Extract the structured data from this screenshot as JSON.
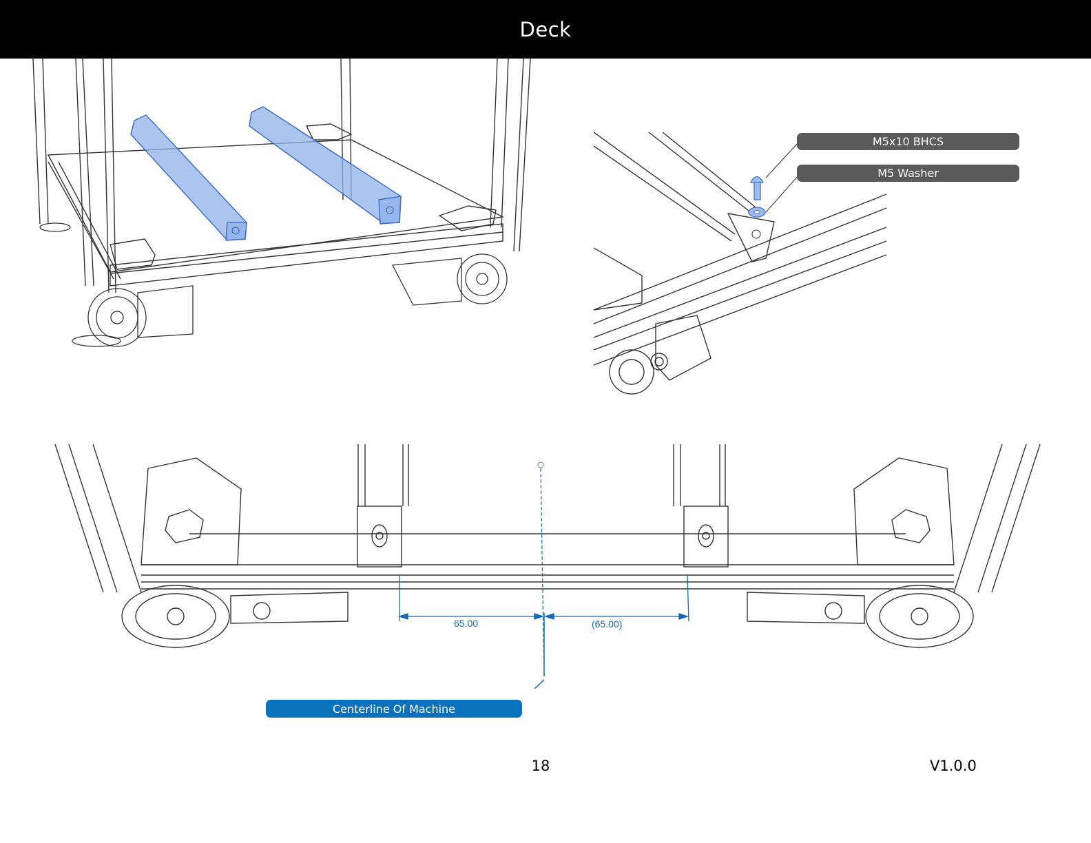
{
  "header": {
    "title": "Deck"
  },
  "callouts": {
    "screw": "M5x10 BHCS",
    "washer": "M5 Washer",
    "centerline": "Centerline Of Machine"
  },
  "dimensions": {
    "left": "65.00",
    "right": "(65.00)"
  },
  "footer": {
    "page_number": "18",
    "version": "V1.0.0"
  },
  "colors": {
    "highlight": "#7fa6e6",
    "callout_gray": "#5a5a5a",
    "callout_blue": "#0a72bd",
    "dimension": "#1566b5"
  }
}
